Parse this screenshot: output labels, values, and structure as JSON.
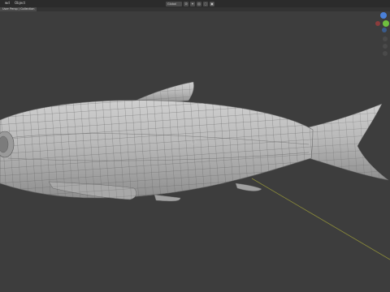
{
  "menubar": {
    "items": [
      "wd",
      "Object"
    ]
  },
  "header": {
    "view_label": "User Persp / Collection",
    "shading_mode": "Global"
  },
  "gizmo": {
    "x_color": "#e05a5a",
    "y_color": "#6fbf3f",
    "z_color": "#4a80d8",
    "neg_x_color": "#8b3c3c"
  },
  "scene": {
    "background_color": "#3d3d3d",
    "mesh_color": "#a9a9a9",
    "wire_color": "#5a5a5a",
    "axis_line_color": "#8a8a3a",
    "object": "fish-mesh"
  }
}
